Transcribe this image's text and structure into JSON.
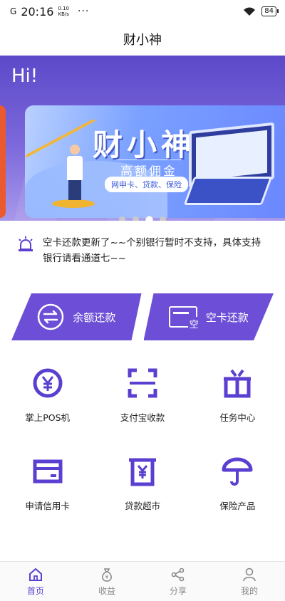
{
  "status_bar": {
    "signal": "G",
    "time": "20:16",
    "speed_value": "0.10",
    "speed_unit": "KB/s",
    "more": "···",
    "battery": "84"
  },
  "header": {
    "title": "财小神"
  },
  "banner": {
    "greeting": "Hi!",
    "card_title": "财小神",
    "card_subtitle": "高额佣金",
    "card_pill": "网申卡、贷款、保险",
    "slide_count": 4,
    "active_slide": 3
  },
  "notice": {
    "line1": "空卡还款更新了~~个别银行暂时不支持，具体支持",
    "line2": "银行请看通道七~~"
  },
  "actions": {
    "balance_repay": "余额还款",
    "empty_card_repay": "空卡还款",
    "empty_card_icon_text": "空"
  },
  "grid": {
    "items": [
      {
        "label": "掌上POS机",
        "icon": "yen-coin-icon"
      },
      {
        "label": "支付宝收款",
        "icon": "scan-icon"
      },
      {
        "label": "任务中心",
        "icon": "gift-box-icon"
      },
      {
        "label": "申请信用卡",
        "icon": "credit-card-icon"
      },
      {
        "label": "贷款超市",
        "icon": "yen-document-icon"
      },
      {
        "label": "保险产品",
        "icon": "umbrella-icon"
      }
    ]
  },
  "tabbar": {
    "tabs": [
      {
        "label": "首页",
        "icon": "home-icon",
        "active": true
      },
      {
        "label": "收益",
        "icon": "money-bag-icon",
        "active": false
      },
      {
        "label": "分享",
        "icon": "share-icon",
        "active": false
      },
      {
        "label": "我的",
        "icon": "user-icon",
        "active": false
      }
    ]
  },
  "colors": {
    "accent": "#6c4fd6",
    "banner": "#5b49c9",
    "orange": "#ea5a2e"
  }
}
